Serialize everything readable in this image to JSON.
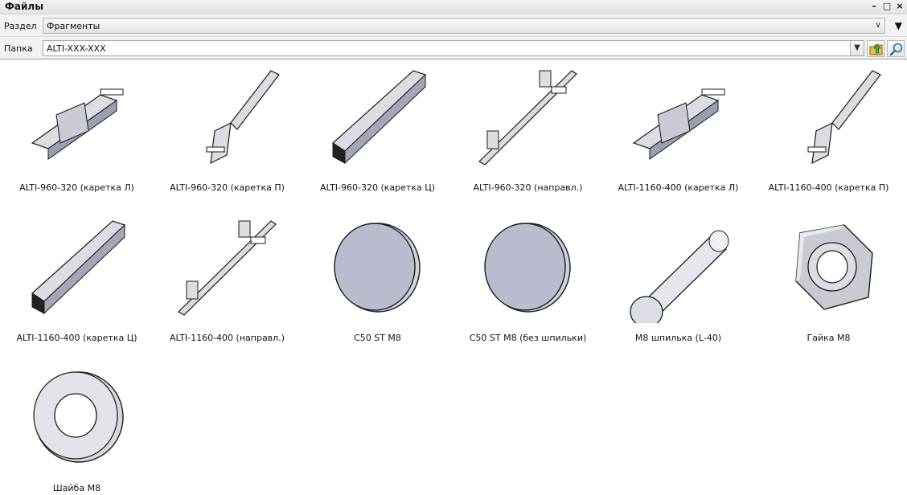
{
  "window": {
    "title": "Файлы",
    "minimize_glyph": "–",
    "restore_glyph": "□",
    "close_glyph": "×"
  },
  "section": {
    "label": "Раздел",
    "value": "Фрагменты",
    "dropdown_glyph": "∨",
    "menu_glyph": "▼"
  },
  "folder": {
    "label": "Папка",
    "value": "ALTI-XXX-XXX",
    "dropdown_glyph": "▼",
    "up_icon": "folder-up-icon",
    "find_icon": "search-icon"
  },
  "files": [
    {
      "label": "ALTI-960-320 (каретка Л)",
      "icon": "rail-carriage-left-thumbnail"
    },
    {
      "label": "ALTI-960-320 (каретка П)",
      "icon": "rail-carriage-right-thumbnail"
    },
    {
      "label": "ALTI-960-320 (каретка Ц)",
      "icon": "rail-carriage-center-thumbnail"
    },
    {
      "label": "ALTI-960-320 (направл.)",
      "icon": "rail-guide-thumbnail"
    },
    {
      "label": "ALTI-1160-400 (каретка Л)",
      "icon": "rail-carriage-left-thumbnail"
    },
    {
      "label": "ALTI-1160-400 (каретка П)",
      "icon": "rail-carriage-right-thumbnail"
    },
    {
      "label": "ALTI-1160-400 (каретка Ц)",
      "icon": "rail-carriage-center-thumbnail"
    },
    {
      "label": "ALTI-1160-400 (направл.)",
      "icon": "rail-guide-thumbnail"
    },
    {
      "label": "C50 ST M8",
      "icon": "disc-thumbnail"
    },
    {
      "label": "C50 ST M8 (без шпильки)",
      "icon": "disc-thumbnail"
    },
    {
      "label": "M8 шпилька (L-40)",
      "icon": "stud-cylinder-thumbnail"
    },
    {
      "label": "Гайка M8",
      "icon": "hex-nut-thumbnail"
    },
    {
      "label": "Шайба M8",
      "icon": "washer-thumbnail"
    }
  ],
  "colors": {
    "part_fill": "#b8bccd",
    "part_stroke": "#1a1a1a",
    "metal_fill": "#dcdde2"
  }
}
